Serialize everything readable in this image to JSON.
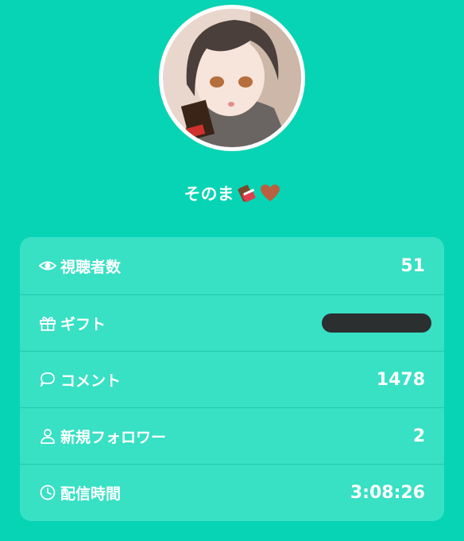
{
  "profile": {
    "name": "そのま",
    "emoji": [
      "chocolate-bar-emoji",
      "brown-heart-emoji"
    ]
  },
  "stats": [
    {
      "icon": "eye-icon",
      "label": "視聴者数",
      "value": "51"
    },
    {
      "icon": "gift-icon",
      "label": "ギフト",
      "value": ""
    },
    {
      "icon": "comment-icon",
      "label": "コメント",
      "value": "1478"
    },
    {
      "icon": "person-icon",
      "label": "新規フォロワー",
      "value": "2"
    },
    {
      "icon": "clock-icon",
      "label": "配信時間",
      "value": "3:08:26"
    }
  ],
  "colors": {
    "background": "#07d4b4",
    "card": "#38e0c4",
    "redaction": "#2b2f30"
  }
}
